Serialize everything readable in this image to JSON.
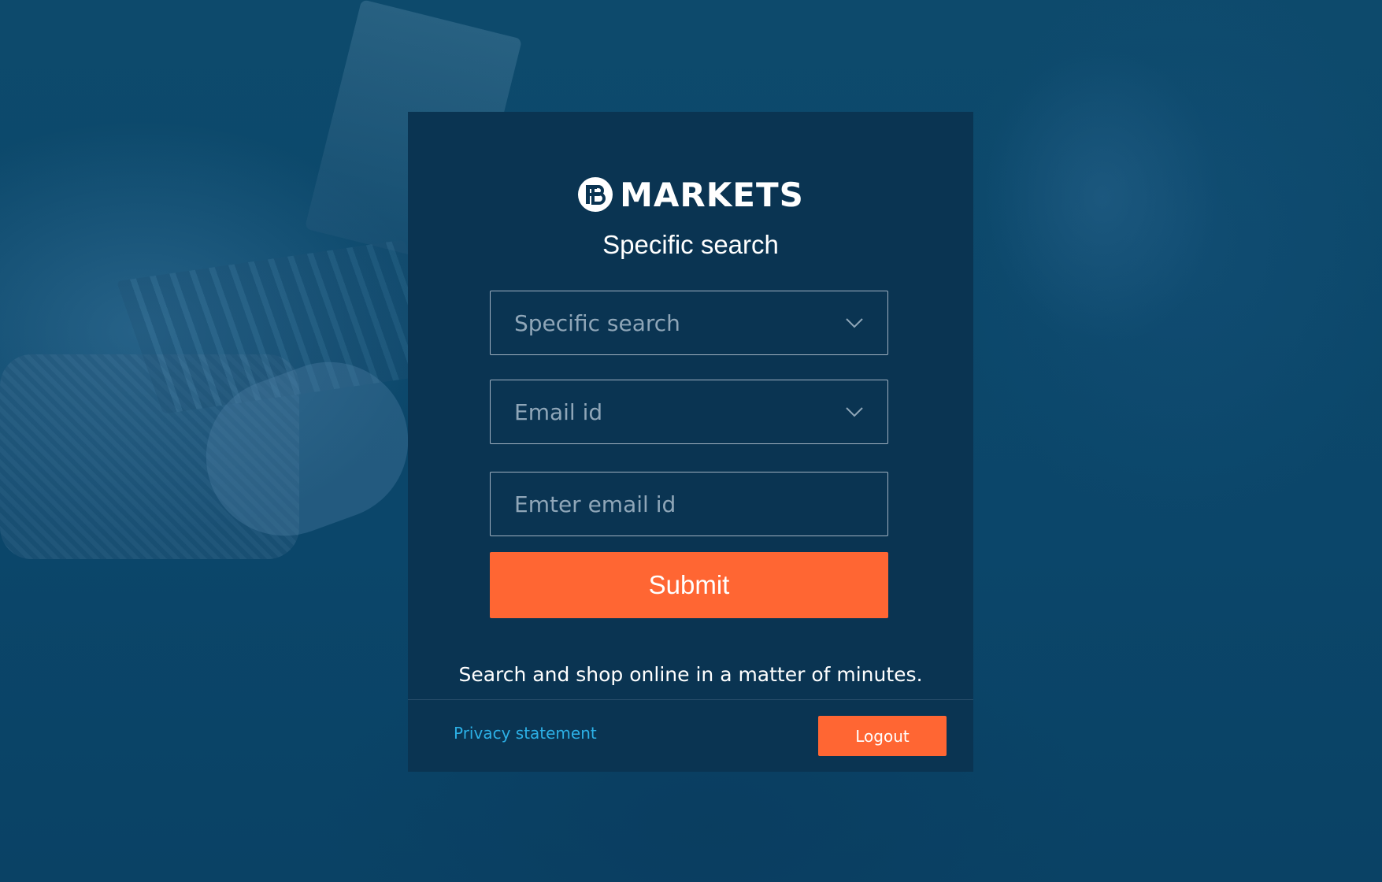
{
  "brand": {
    "logo_icon": "fb-circle-logo",
    "name": "MARKETS"
  },
  "form": {
    "title": "Specific search",
    "search_type": {
      "value": "Specific search",
      "icon": "chevron-down-icon"
    },
    "email_type": {
      "value": "Email id",
      "icon": "chevron-down-icon"
    },
    "email_input": {
      "placeholder": "Emter email id",
      "value": ""
    },
    "submit_label": "Submit"
  },
  "tagline": "Search and shop online in a matter of minutes.",
  "footer": {
    "privacy_label": "Privacy statement",
    "logout_label": "Logout"
  },
  "colors": {
    "background": "#0b466a",
    "card": "#0a3452",
    "accent": "#ff6633",
    "link": "#2cb0e6",
    "border": "#9fb0c0"
  }
}
